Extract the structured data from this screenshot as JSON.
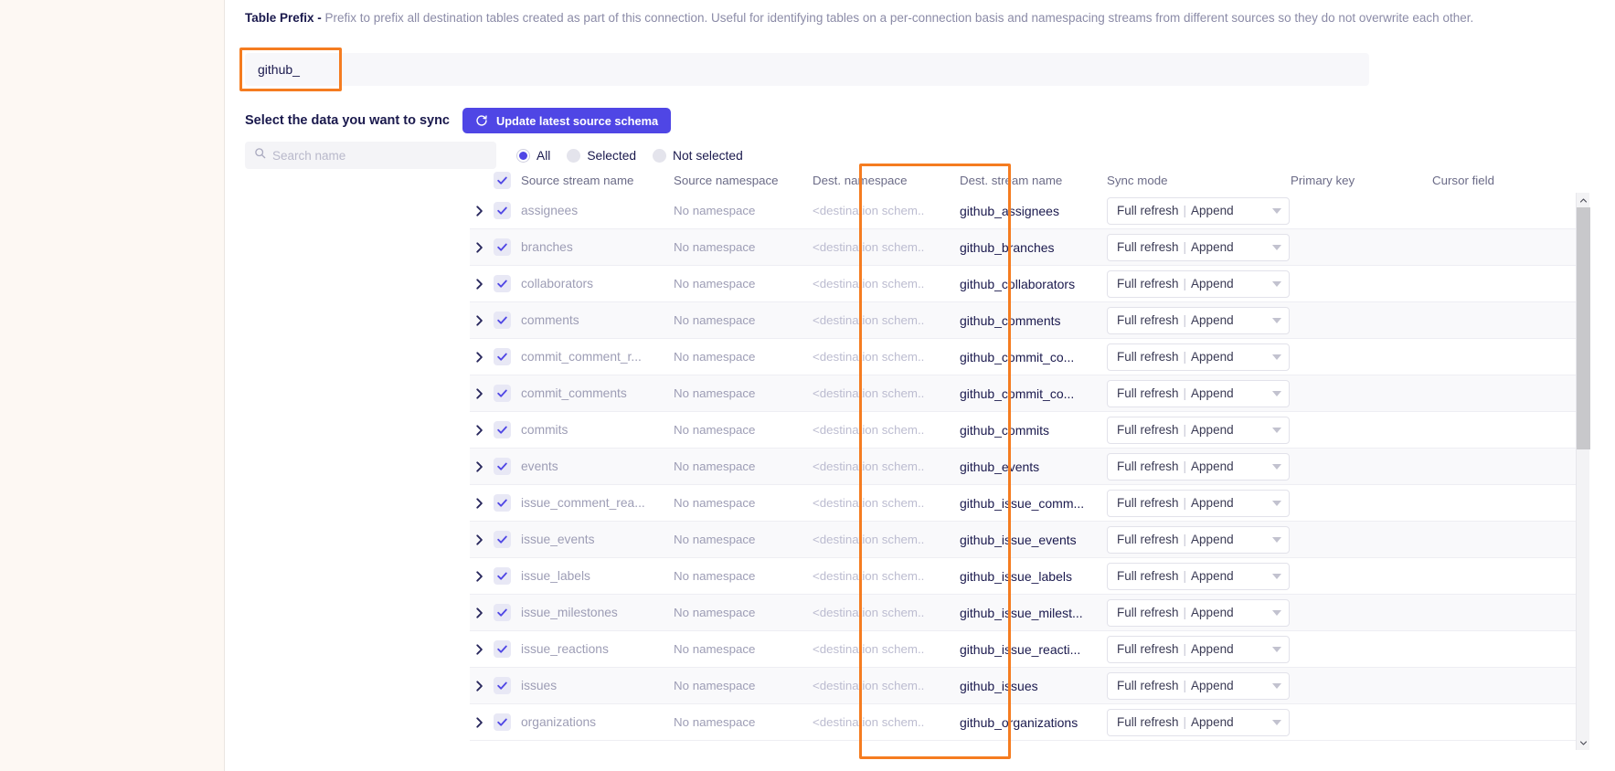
{
  "prefix": {
    "label": "Table Prefix -",
    "description": " Prefix to prefix all destination tables created as part of this connection. Useful for identifying tables on a per-connection basis and namespacing streams from different sources so they do not overwrite each other.",
    "value": "github_",
    "placeholder": ""
  },
  "section": {
    "title": "Select the data you want to sync",
    "update_button": "Update latest source schema",
    "update_icon": "refresh-icon"
  },
  "search": {
    "placeholder": "Search name",
    "value": "",
    "icon": "search-icon"
  },
  "filters": [
    {
      "label": "All",
      "selected": true
    },
    {
      "label": "Selected",
      "selected": false
    },
    {
      "label": "Not selected",
      "selected": false
    }
  ],
  "columns": [
    "Source stream name",
    "Source namespace",
    "Dest. namespace",
    "Dest. stream name",
    "Sync mode",
    "Primary key",
    "Cursor field"
  ],
  "sync_mode": {
    "primary": "Full refresh",
    "separator": "|",
    "secondary": "Append"
  },
  "common": {
    "source_namespace": "No namespace",
    "dest_namespace": "<destination schem..",
    "expand_icon": "chevron-right-icon",
    "check_icon": "check-icon"
  },
  "header_checkbox": {
    "checked": true
  },
  "rows": [
    {
      "source": "assignees",
      "dest": "github_assignees"
    },
    {
      "source": "branches",
      "dest": "github_branches"
    },
    {
      "source": "collaborators",
      "dest": "github_collaborators"
    },
    {
      "source": "comments",
      "dest": "github_comments"
    },
    {
      "source": "commit_comment_r...",
      "dest": "github_commit_co..."
    },
    {
      "source": "commit_comments",
      "dest": "github_commit_co..."
    },
    {
      "source": "commits",
      "dest": "github_commits"
    },
    {
      "source": "events",
      "dest": "github_events"
    },
    {
      "source": "issue_comment_rea...",
      "dest": "github_issue_comm..."
    },
    {
      "source": "issue_events",
      "dest": "github_issue_events"
    },
    {
      "source": "issue_labels",
      "dest": "github_issue_labels"
    },
    {
      "source": "issue_milestones",
      "dest": "github_issue_milest..."
    },
    {
      "source": "issue_reactions",
      "dest": "github_issue_reacti..."
    },
    {
      "source": "issues",
      "dest": "github_issues"
    },
    {
      "source": "organizations",
      "dest": "github_organizations"
    }
  ],
  "scrollbar": {
    "up_icon": "chevron-up-icon",
    "down_icon": "chevron-down-icon"
  },
  "colors": {
    "accent": "#4f46e5",
    "highlight": "#f57c20",
    "text": "#1a194d",
    "muted": "#9d9db5"
  }
}
